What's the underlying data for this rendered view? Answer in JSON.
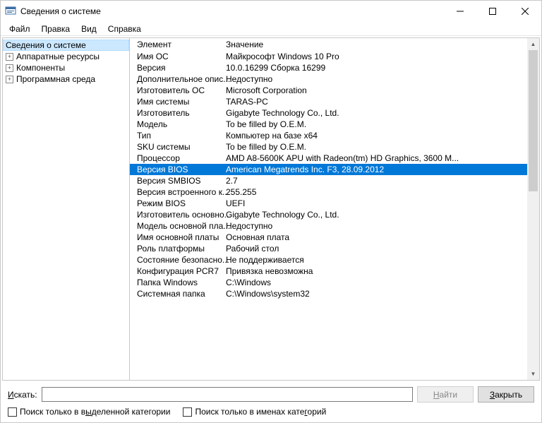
{
  "window": {
    "title": "Сведения о системе"
  },
  "menu": {
    "file": "Файл",
    "edit": "Правка",
    "view": "Вид",
    "help": "Справка"
  },
  "tree": {
    "root": "Сведения о системе",
    "hardware": "Аппаратные ресурсы",
    "components": "Компоненты",
    "software": "Программная среда"
  },
  "list_headers": {
    "element": "Элемент",
    "value": "Значение"
  },
  "rows": [
    {
      "k": "Имя ОС",
      "v": "Майкрософт Windows 10 Pro"
    },
    {
      "k": "Версия",
      "v": "10.0.16299 Сборка 16299"
    },
    {
      "k": "Дополнительное опис...",
      "v": "Недоступно"
    },
    {
      "k": "Изготовитель ОС",
      "v": "Microsoft Corporation"
    },
    {
      "k": "Имя системы",
      "v": "TARAS-PC"
    },
    {
      "k": "Изготовитель",
      "v": "Gigabyte Technology Co., Ltd."
    },
    {
      "k": "Модель",
      "v": "To be filled by O.E.M."
    },
    {
      "k": "Тип",
      "v": "Компьютер на базе x64"
    },
    {
      "k": "SKU системы",
      "v": "To be filled by O.E.M."
    },
    {
      "k": "Процессор",
      "v": "AMD A8-5600K APU with Radeon(tm) HD Graphics, 3600 М..."
    },
    {
      "k": "Версия BIOS",
      "v": "American Megatrends Inc. F3, 28.09.2012",
      "selected": true
    },
    {
      "k": "Версия SMBIOS",
      "v": "2.7"
    },
    {
      "k": "Версия встроенного к...",
      "v": "255.255"
    },
    {
      "k": "Режим BIOS",
      "v": "UEFI"
    },
    {
      "k": "Изготовитель основно...",
      "v": "Gigabyte Technology Co., Ltd."
    },
    {
      "k": "Модель основной пла...",
      "v": "Недоступно"
    },
    {
      "k": "Имя основной платы",
      "v": "Основная плата"
    },
    {
      "k": "Роль платформы",
      "v": "Рабочий стол"
    },
    {
      "k": "Состояние безопасно...",
      "v": "Не поддерживается"
    },
    {
      "k": "Конфигурация PCR7",
      "v": "Привязка невозможна"
    },
    {
      "k": "Папка Windows",
      "v": "C:\\Windows"
    },
    {
      "k": "Системная папка",
      "v": "C:\\Windows\\system32"
    }
  ],
  "footer": {
    "search_label": "Искать:",
    "find_btn": "Найти",
    "close_btn": "Закрыть",
    "check1": "Поиск только в выделенной категории",
    "check2": "Поиск только в именах категорий"
  }
}
